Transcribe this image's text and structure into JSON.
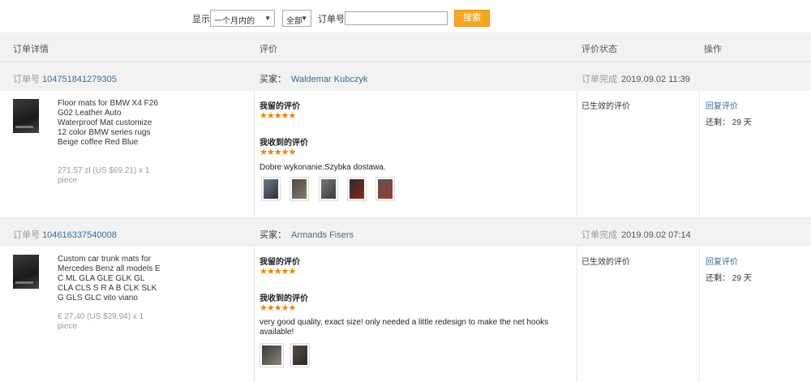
{
  "filter": {
    "show_label": "显示",
    "period_value": "一个月内的",
    "scope_value": "全部",
    "order_label": "订单号",
    "order_value": "",
    "search_label": "搜索"
  },
  "table": {
    "headers": [
      "订单详情",
      "评价",
      "评价状态",
      "操作"
    ]
  },
  "labels": {
    "order_no": "订单号",
    "buyer": "买家：",
    "completed": "订单完成",
    "my_review": "我留的评价",
    "received_review": "我收到的评价",
    "reply": "回复评价",
    "remaining_prefix": "还剩：",
    "remaining_suffix": "天",
    "stars": "★★★★★"
  },
  "orders": [
    {
      "order_id": "104751841279305",
      "buyer": "Waldemar Kubczyk",
      "completed_time": "2019.09.02 11:39",
      "product_title": "Floor mats for BMW X4 F26 G02 Leather Auto Waterproof Mat customize 12 color BMW series rugs Beige coffee Red Blue",
      "price": "271,57 zł (US $69.21) x 1 piece",
      "review_text": "Dobre wykonanie.Szybka dostawa.",
      "status": "已生效的评价",
      "days_left": "29",
      "photo_count": 5
    },
    {
      "order_id": "104616337540008",
      "buyer": "Armands Fisers",
      "completed_time": "2019.09.02 07:14",
      "product_title": "Custom car trunk mats for Mercedes Benz all models E C ML GLA GLE GLK GL CLA CLS S R A B CLK SLK G GLS GLC vito viano",
      "price": "€ 27,40 (US $29.94) x 1 piece",
      "review_text": "very good quality, exact size! only needed a little redesign to make the net hooks available!",
      "status": "已生效的评价",
      "days_left": "29",
      "photo_count": 2
    }
  ],
  "colors": {
    "accent_orange": "#f5a623",
    "link_blue": "#3a6d99",
    "star_orange": "#f08200",
    "header_bg": "#f2f2f2"
  }
}
